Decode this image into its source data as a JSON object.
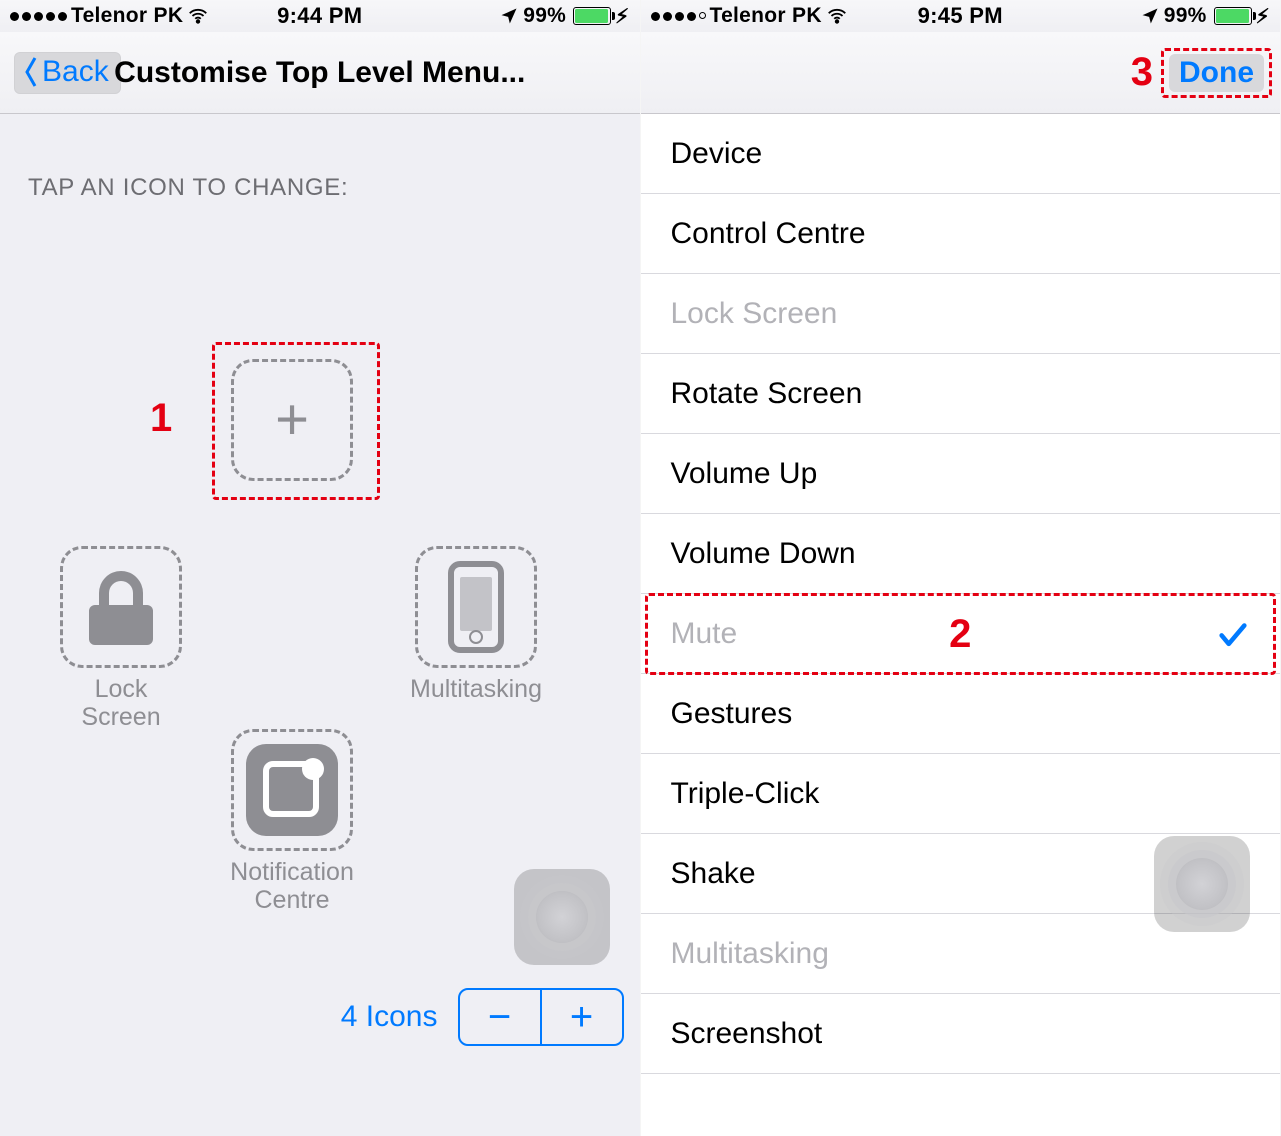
{
  "left": {
    "status": {
      "carrier": "Telenor PK",
      "time": "9:44 PM",
      "battery": "99%"
    },
    "nav": {
      "back": "Back",
      "title": "Customise Top Level Menu..."
    },
    "section_label": "TAP AN ICON TO CHANGE:",
    "slots": {
      "top": {
        "label": ""
      },
      "left": {
        "label": "Lock Screen"
      },
      "right": {
        "label": "Multitasking"
      },
      "bottom": {
        "label": "Notification Centre"
      }
    },
    "count_label": "4 Icons",
    "annotations": {
      "step1": "1"
    }
  },
  "right": {
    "status": {
      "carrier": "Telenor PK",
      "time": "9:45 PM",
      "battery": "99%"
    },
    "nav": {
      "done": "Done"
    },
    "list": [
      {
        "label": "Device",
        "disabled": false,
        "selected": false
      },
      {
        "label": "Control Centre",
        "disabled": false,
        "selected": false
      },
      {
        "label": "Lock Screen",
        "disabled": true,
        "selected": false
      },
      {
        "label": "Rotate Screen",
        "disabled": false,
        "selected": false
      },
      {
        "label": "Volume Up",
        "disabled": false,
        "selected": false
      },
      {
        "label": "Volume Down",
        "disabled": false,
        "selected": false
      },
      {
        "label": "Mute",
        "disabled": true,
        "selected": true
      },
      {
        "label": "Gestures",
        "disabled": false,
        "selected": false
      },
      {
        "label": "Triple-Click",
        "disabled": false,
        "selected": false
      },
      {
        "label": "Shake",
        "disabled": false,
        "selected": false
      },
      {
        "label": "Multitasking",
        "disabled": true,
        "selected": false
      },
      {
        "label": "Screenshot",
        "disabled": false,
        "selected": false
      }
    ],
    "annotations": {
      "step2": "2",
      "step3": "3"
    }
  }
}
